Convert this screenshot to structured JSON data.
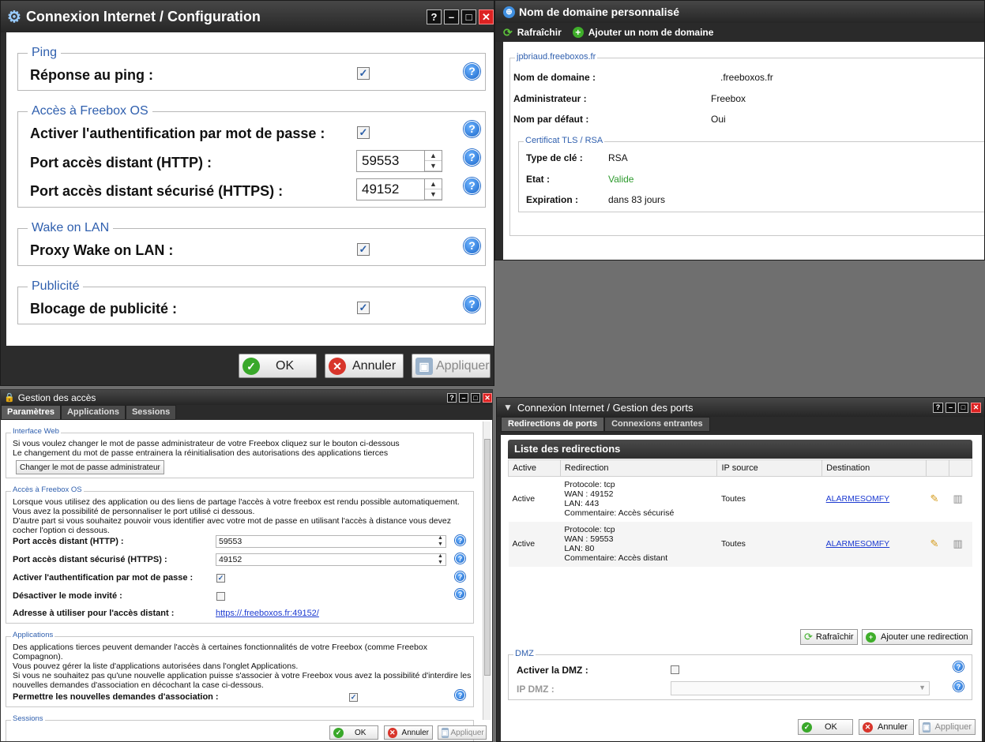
{
  "win1": {
    "title": "Connexion Internet / Configuration",
    "controls": [
      "?",
      "–",
      "□",
      "✕"
    ],
    "sections": [
      {
        "legend": "Ping",
        "rows": [
          {
            "label": "Réponse au ping :",
            "checked": "✓"
          }
        ]
      },
      {
        "legend": "Accès à Freebox OS",
        "rows": [
          {
            "label": "Activer l'authentification par mot de passe :",
            "checked": "✓"
          },
          {
            "label": "Port accès distant (HTTP) :",
            "value": "59553"
          },
          {
            "label": "Port accès distant sécurisé (HTTPS) :",
            "value": "49152"
          }
        ]
      },
      {
        "legend": "Wake on LAN",
        "rows": [
          {
            "label": "Proxy Wake on LAN :",
            "checked": "✓"
          }
        ]
      },
      {
        "legend": "Publicité",
        "rows": [
          {
            "label": "Blocage de publicité :",
            "checked": "✓"
          }
        ]
      }
    ],
    "buttons": {
      "ok": "OK",
      "cancel": "Annuler",
      "apply": "Appliquer"
    }
  },
  "win2": {
    "title": "Nom de domaine personnalisé",
    "toolbar": {
      "refresh": "Rafraîchir",
      "add": "Ajouter un nom de domaine"
    },
    "legend": "jpbriaud.freeboxos.fr",
    "rows": [
      {
        "label": "Nom de domaine :",
        "value": ".freeboxos.fr"
      },
      {
        "label": "Administrateur :",
        "value": "Freebox"
      },
      {
        "label": "Nom par défaut :",
        "value": "Oui"
      }
    ],
    "cert": {
      "legend": "Certificat TLS / RSA",
      "rows": [
        {
          "label": "Type de clé :",
          "value": "RSA"
        },
        {
          "label": "Etat :",
          "value": "Valide"
        },
        {
          "label": "Expiration :",
          "value": "dans 83 jours"
        }
      ]
    },
    "valid_color": "#2e9a2e"
  },
  "win3": {
    "title": "Gestion des accès",
    "tabs": [
      "Paramètres",
      "Applications",
      "Sessions"
    ],
    "web": {
      "legend": "Interface Web",
      "line1": "Si vous voulez changer le mot de passe administrateur de votre Freebox cliquez sur le bouton ci-dessous",
      "line2": "Le changement du mot de passe entrainera la réinitialisation des autorisations des applications tierces",
      "button": "Changer le mot de passe administrateur"
    },
    "access": {
      "legend": "Accès à Freebox OS",
      "line1": "Lorsque vous utilisez des application ou des liens de partage l'accès à votre freebox est rendu possible automatiquement.",
      "line2": "Vous avez la possibilité de personnaliser le port utilisé ci dessous.",
      "line3": "D'autre part si vous souhaitez pouvoir vous identifier avec votre mot de passe en utilisant l'accès à distance vous devez",
      "line4": "cocher l'option ci dessous.",
      "http_label": "Port accès distant (HTTP) :",
      "http_value": "59553",
      "https_label": "Port accès distant sécurisé (HTTPS) :",
      "https_value": "49152",
      "auth_label": "Activer l'authentification par mot de passe :",
      "auth_checked": "✓",
      "guest_label": "Désactiver le mode invité :",
      "url_label": "Adresse à utiliser pour l'accès distant :",
      "url": "https://.freeboxos.fr:49152/"
    },
    "apps": {
      "legend": "Applications",
      "line1": "Des applications tierces peuvent demander l'accès à certaines fonctionnalités de votre Freebox (comme Freebox",
      "line2": "Compagnon).",
      "line3": "Vous pouvez gérer la liste d'applications autorisées dans l'onglet Applications.",
      "line4": "Si vous ne souhaitez pas qu'une nouvelle application puisse s'associer à votre Freebox vous avez la possibilité d'interdire les",
      "line5": "nouvelles demandes d'association en décochant la case ci-dessous.",
      "allow_label": "Permettre les nouvelles demandes d'association :",
      "allow_checked": "✓"
    },
    "sessions_legend": "Sessions",
    "buttons": {
      "ok": "OK",
      "cancel": "Annuler",
      "apply": "Appliquer"
    }
  },
  "win4": {
    "title": "Connexion Internet / Gestion des ports",
    "tabs": [
      "Redirections de ports",
      "Connexions entrantes"
    ],
    "list_title": "Liste des redirections",
    "columns": [
      "Active",
      "Redirection",
      "IP source",
      "Destination"
    ],
    "rows": [
      {
        "active": "Active",
        "proto": "Protocole: tcp",
        "wan": "WAN : 49152",
        "lan": "LAN: 443",
        "comment": "Commentaire: Accès sécurisé",
        "source": "Toutes",
        "dest": "ALARMESOMFY"
      },
      {
        "active": "Active",
        "proto": "Protocole: tcp",
        "wan": "WAN : 59553",
        "lan": "LAN: 80",
        "comment": "Commentaire: Accès distant",
        "source": "Toutes",
        "dest": "ALARMESOMFY"
      }
    ],
    "refresh": "Rafraîchir",
    "add": "Ajouter une redirection",
    "dmz": {
      "legend": "DMZ",
      "activate": "Activer la DMZ :",
      "ip": "IP DMZ :"
    },
    "buttons": {
      "ok": "OK",
      "cancel": "Annuler",
      "apply": "Appliquer"
    }
  },
  "icons": {
    "help": "?",
    "ok": "✓",
    "cancel": "✕",
    "add": "+",
    "refresh": "⟳",
    "up": "▲",
    "down": "▼"
  }
}
